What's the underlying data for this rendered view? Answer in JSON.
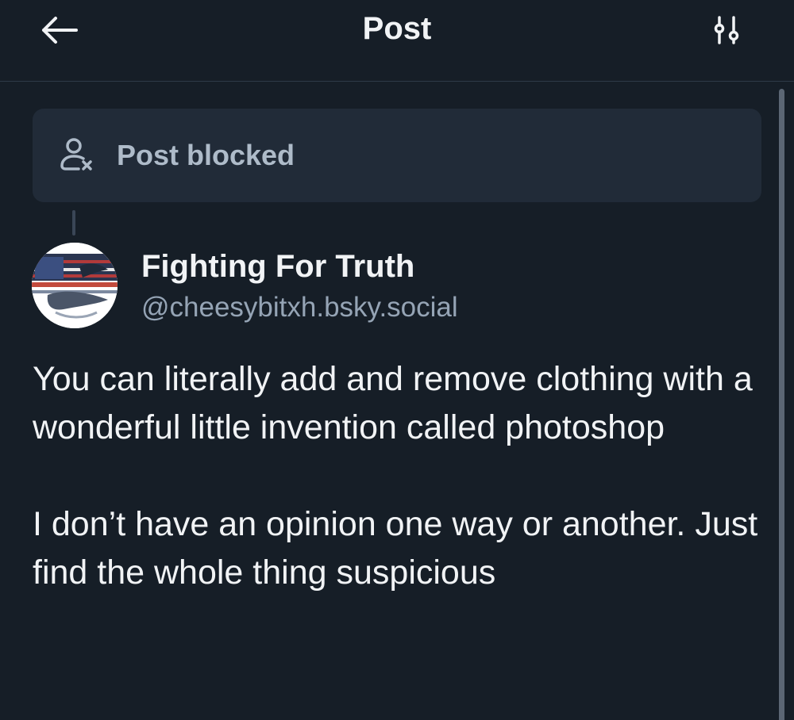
{
  "header": {
    "title": "Post",
    "back_icon": "arrow-left-icon",
    "filter_icon": "sliders-icon"
  },
  "blocked_notice": {
    "label": "Post blocked",
    "icon": "person-x-icon"
  },
  "post": {
    "author": {
      "display_name": "Fighting For Truth",
      "handle": "@cheesybitxh.bsky.social"
    },
    "paragraphs": [
      "You can literally add and remove clothing with a wonderful little invention called photoshop",
      "I don’t have an opinion one way or another. Just find the whole thing suspicious"
    ]
  },
  "colors": {
    "background": "#161e27",
    "card": "#212b38",
    "text_primary": "#f1f3f5",
    "text_muted": "#95a4b5"
  }
}
